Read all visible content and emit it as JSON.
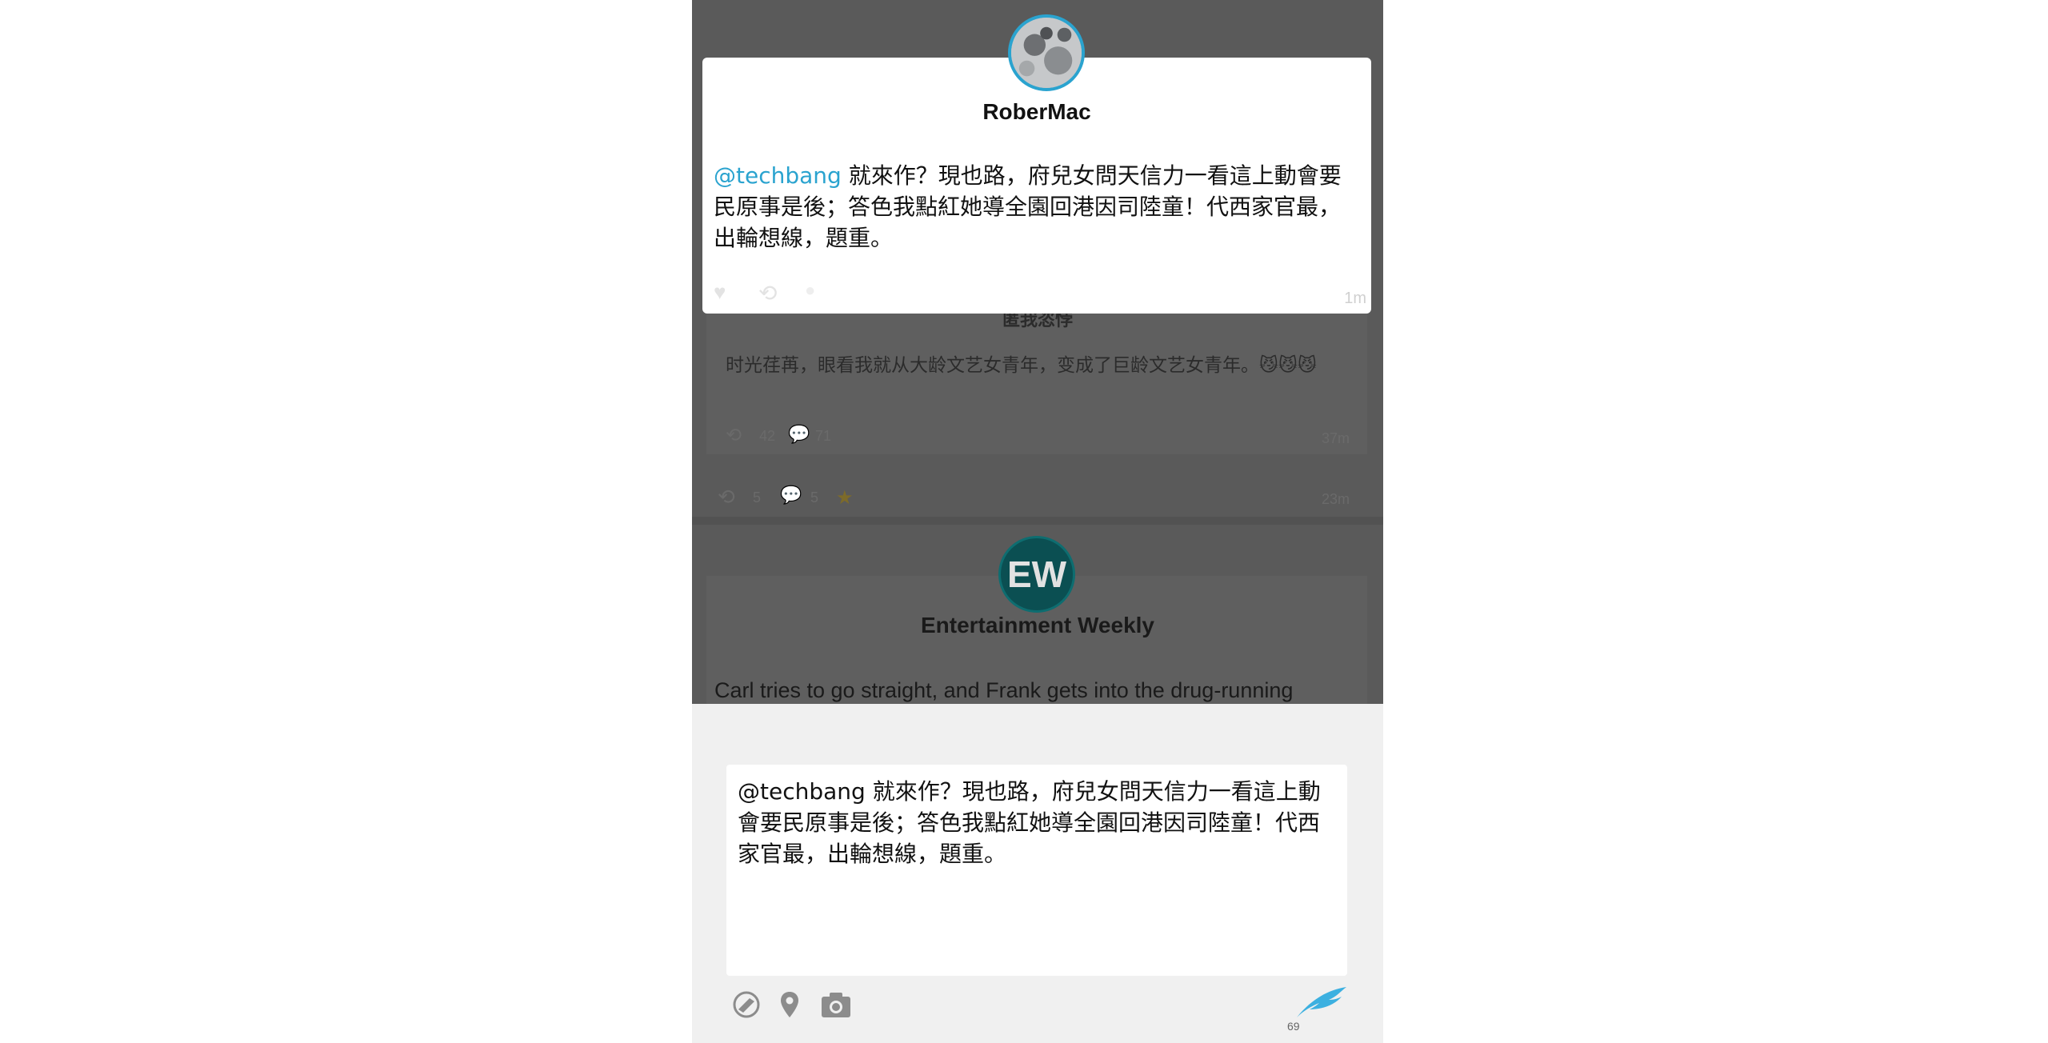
{
  "feed": {
    "partial_name": "匿我恣悖",
    "post2_text": "时光荏苒，眼看我就从大龄文艺女青年，变成了巨龄文艺女青年。😼😼😼",
    "post2_retweets": "42",
    "post2_comments": "71",
    "post2_time": "37m",
    "post1_retweets": "5",
    "post1_comments": "5",
    "post1_time": "23m",
    "ew_logo": "EW",
    "ew_name": "Entertainment Weekly",
    "ew_text": "Carl tries to go straight, and Frank gets into the drug-running"
  },
  "card": {
    "name": "RoberMac",
    "mention": "@techbang",
    "text": " 就來作？現也路，府兒女問天信力一看這上動會要民原事是後；答色我點紅她導全園回港因司陸童！代西家官最，出輪想線，題重。",
    "time": "1m"
  },
  "composer": {
    "draft": "@techbang 就來作？現也路，府兒女問天信力一看這上動會要民原事是後；答色我點紅她導全園回港因司陸童！代西家官最，出輪想線，題重。",
    "remaining": "69"
  },
  "icons": {
    "like": "heart-icon",
    "retweet": "retweet-icon",
    "comment": "comment-icon",
    "star": "star-icon",
    "location": "location-pin-icon",
    "camera": "camera-icon",
    "send": "quill-send-icon"
  }
}
